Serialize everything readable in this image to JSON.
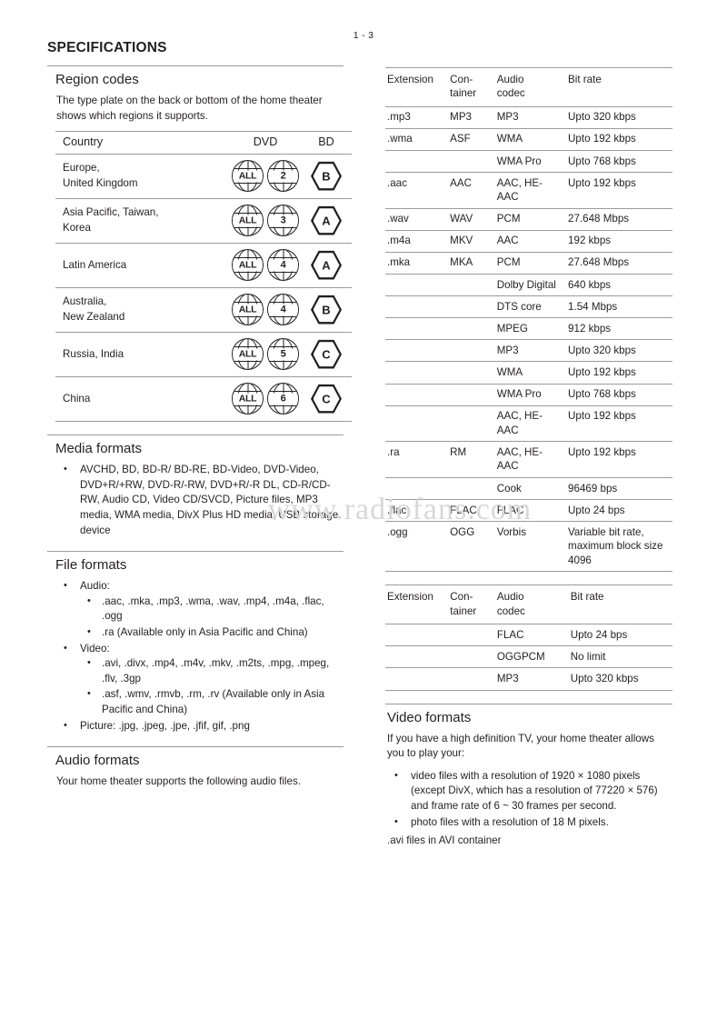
{
  "page": {
    "number": "1 - 3",
    "title": "SPECIFICATIONS",
    "watermark": "www.radiofans.com"
  },
  "region_codes": {
    "heading": "Region codes",
    "intro": "The type plate on the back or bottom of the home theater shows which regions it supports.",
    "columns": [
      "Country",
      "DVD",
      "BD"
    ],
    "rows": [
      {
        "country": "Europe,\nUnited Kingdom",
        "dvd": [
          "ALL",
          "2"
        ],
        "bd": "B"
      },
      {
        "country": "Asia Pacific, Taiwan,\nKorea",
        "dvd": [
          "ALL",
          "3"
        ],
        "bd": "A"
      },
      {
        "country": "Latin America",
        "dvd": [
          "ALL",
          "4"
        ],
        "bd": "A"
      },
      {
        "country": "Australia,\nNew Zealand",
        "dvd": [
          "ALL",
          "4"
        ],
        "bd": "B"
      },
      {
        "country": "Russia, India",
        "dvd": [
          "ALL",
          "5"
        ],
        "bd": "C"
      },
      {
        "country": "China",
        "dvd": [
          "ALL",
          "6"
        ],
        "bd": "C"
      }
    ]
  },
  "media_formats": {
    "heading": "Media formats",
    "items": [
      "AVCHD, BD, BD-R/ BD-RE, BD-Video, DVD-Video, DVD+R/+RW, DVD-R/-RW, DVD+R/-R DL, CD-R/CD-RW, Audio CD, Video CD/SVCD, Picture files, MP3 media, WMA media, DivX Plus HD media, USB storage device"
    ]
  },
  "file_formats": {
    "heading": "File formats",
    "groups": [
      {
        "label": "Audio:",
        "items": [
          ".aac, .mka, .mp3, .wma, .wav, .mp4, .m4a, .flac, .ogg",
          ".ra (Available only in Asia Pacific and China)"
        ]
      },
      {
        "label": "Video:",
        "items": [
          ".avi, .divx, .mp4, .m4v, .mkv, .m2ts, .mpg, .mpeg, .flv, .3gp",
          ".asf, .wmv, .rmvb, .rm, .rv (Available only in Asia Pacific and China)"
        ]
      }
    ],
    "picture": "Picture: .jpg, .jpeg, .jpe, .jfif, gif, .png"
  },
  "audio_formats": {
    "heading": "Audio formats",
    "intro": "Your home theater supports the following audio files.",
    "columns": [
      "Extension",
      "Con-\ntainer",
      "Audio\ncodec",
      "Bit rate"
    ],
    "table1": [
      {
        "ext": ".mp3",
        "container": "MP3",
        "codec": "MP3",
        "bitrate": "Upto 320 kbps"
      },
      {
        "ext": ".wma",
        "container": "ASF",
        "codec": "WMA",
        "bitrate": "Upto 192 kbps"
      },
      {
        "ext": "",
        "container": "",
        "codec": "WMA Pro",
        "bitrate": "Upto 768 kbps"
      },
      {
        "ext": ".aac",
        "container": "AAC",
        "codec": "AAC, HE-AAC",
        "bitrate": "Upto 192 kbps"
      },
      {
        "ext": ".wav",
        "container": "WAV",
        "codec": "PCM",
        "bitrate": "27.648 Mbps"
      },
      {
        "ext": ".m4a",
        "container": "MKV",
        "codec": "AAC",
        "bitrate": "192 kbps"
      },
      {
        "ext": ".mka",
        "container": "MKA",
        "codec": "PCM",
        "bitrate": "27.648 Mbps"
      },
      {
        "ext": "",
        "container": "",
        "codec": "Dolby Digital",
        "bitrate": "640 kbps"
      },
      {
        "ext": "",
        "container": "",
        "codec": "DTS core",
        "bitrate": "1.54 Mbps"
      },
      {
        "ext": "",
        "container": "",
        "codec": "MPEG",
        "bitrate": "912 kbps"
      },
      {
        "ext": "",
        "container": "",
        "codec": "MP3",
        "bitrate": "Upto 320 kbps"
      },
      {
        "ext": "",
        "container": "",
        "codec": "WMA",
        "bitrate": "Upto 192 kbps"
      },
      {
        "ext": "",
        "container": "",
        "codec": "WMA Pro",
        "bitrate": "Upto 768 kbps"
      },
      {
        "ext": "",
        "container": "",
        "codec": "AAC, HE-AAC",
        "bitrate": "Upto 192 kbps"
      },
      {
        "ext": ".ra",
        "container": "RM",
        "codec": "AAC, HE-AAC",
        "bitrate": "Upto 192 kbps"
      },
      {
        "ext": "",
        "container": "",
        "codec": "Cook",
        "bitrate": "96469 bps"
      },
      {
        "ext": ".flac",
        "container": "FLAC",
        "codec": "FLAC",
        "bitrate": "Upto 24 bps"
      },
      {
        "ext": ".ogg",
        "container": "OGG",
        "codec": "Vorbis",
        "bitrate": "Variable bit rate, maximum block size 4096"
      }
    ],
    "table2": [
      {
        "ext": "",
        "container": "",
        "codec": "FLAC",
        "bitrate": "Upto 24 bps"
      },
      {
        "ext": "",
        "container": "",
        "codec": "OGGPCM",
        "bitrate": "No limit"
      },
      {
        "ext": "",
        "container": "",
        "codec": "MP3",
        "bitrate": "Upto 320 kbps"
      }
    ]
  },
  "video_formats": {
    "heading": "Video formats",
    "intro": "If you have a high definition TV, your home theater allows you to play your:",
    "items": [
      "video files with a resolution of 1920 × 1080 pixels (except DivX, which has a resolution of 77220 × 576) and frame rate of 6 ~ 30 frames per second.",
      "photo files with a resolution of 18 M pixels."
    ],
    "note": ".avi files in AVI container"
  }
}
